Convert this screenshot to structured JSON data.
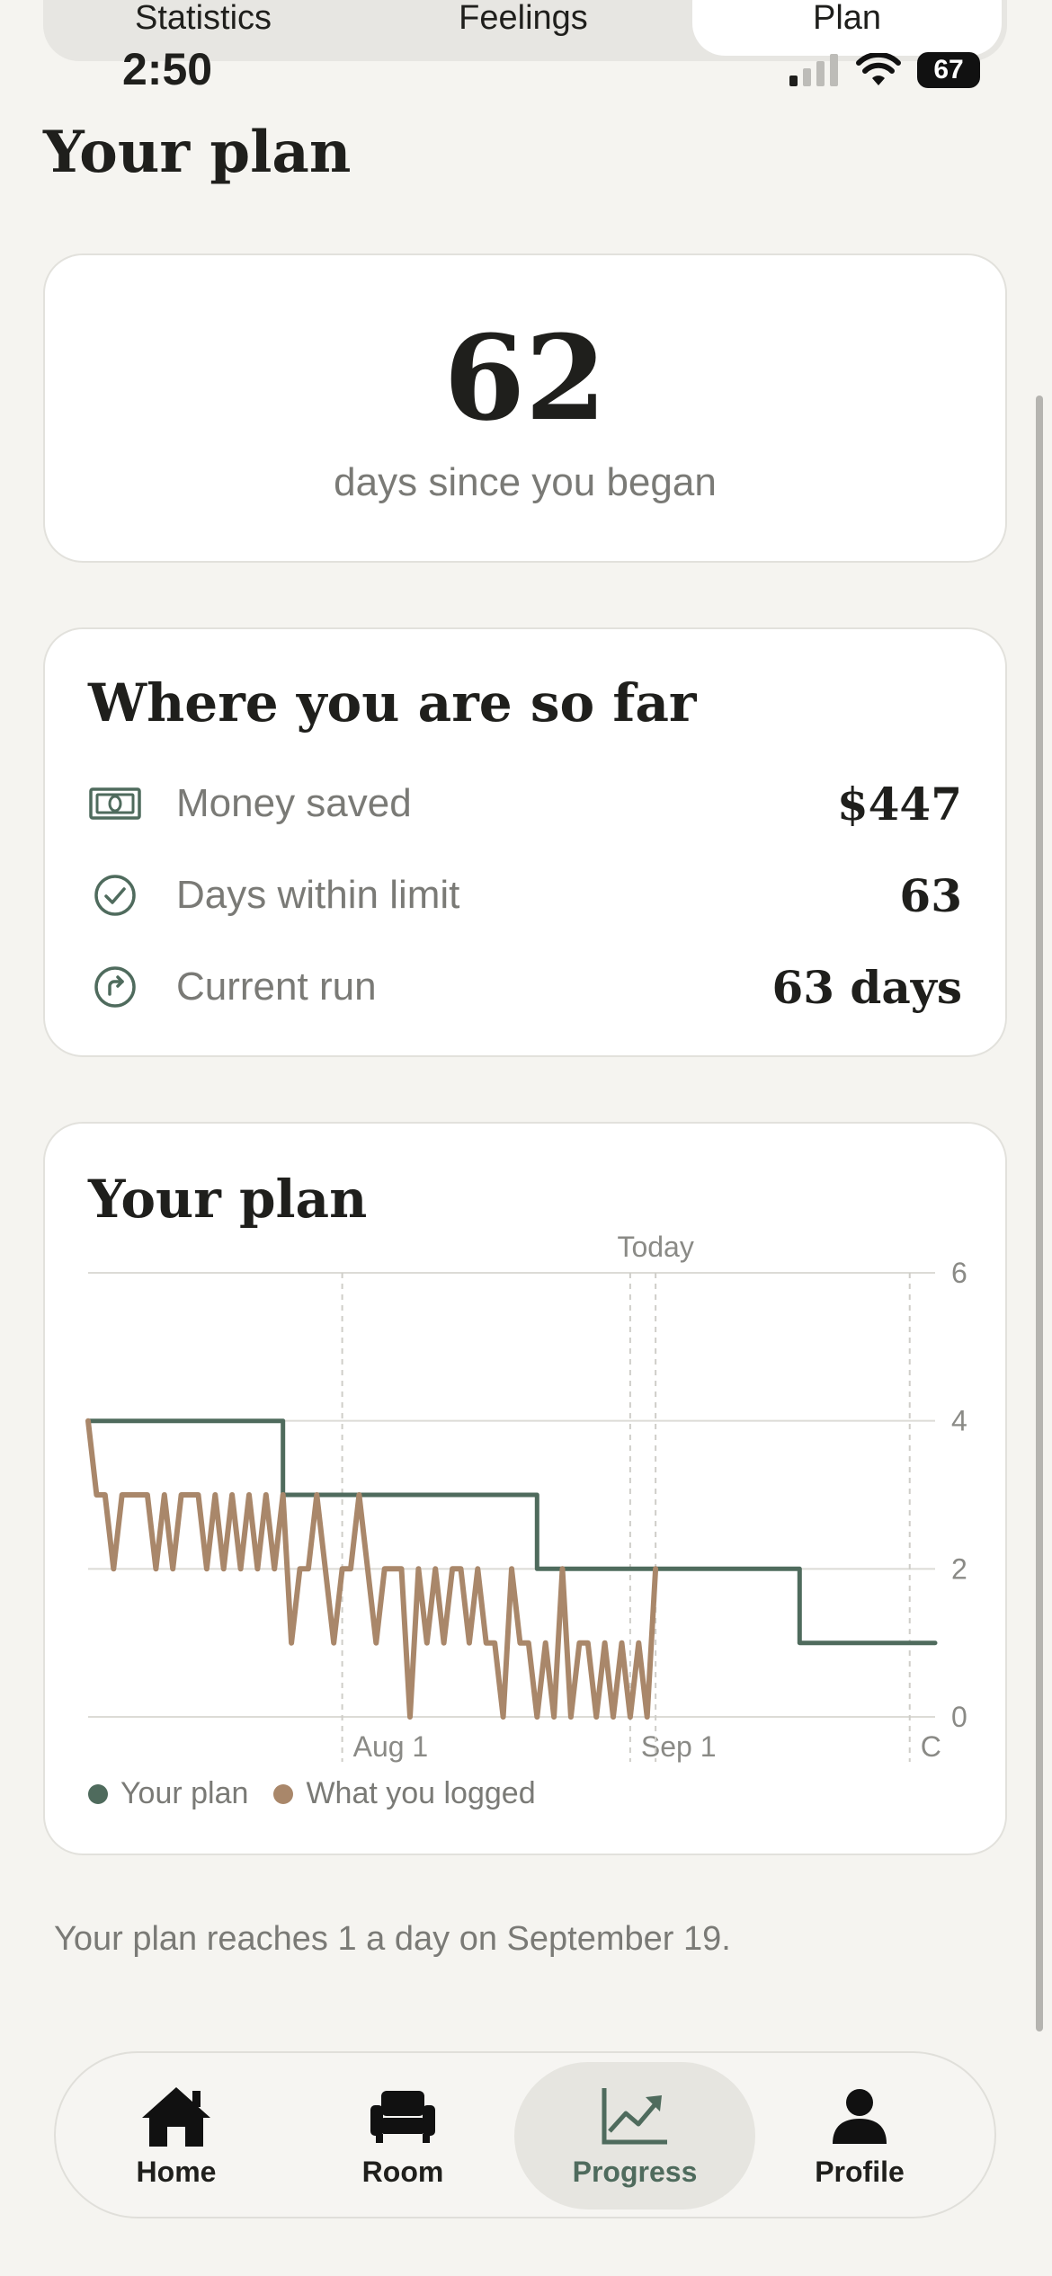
{
  "segments": [
    "Statistics",
    "Feelings",
    "Plan"
  ],
  "status": {
    "time": "2:50",
    "battery": "67"
  },
  "page_title": "Your plan",
  "days_card": {
    "number": "62",
    "caption": "days since you began"
  },
  "progress_card": {
    "title": "Where you are so far",
    "rows": [
      {
        "icon": "money-icon",
        "label": "Money saved",
        "value": "$447"
      },
      {
        "icon": "check-circle-icon",
        "label": "Days within limit",
        "value": "63"
      },
      {
        "icon": "streak-arrow-icon",
        "label": "Current run",
        "value": "63 days"
      }
    ]
  },
  "plan_card": {
    "title": "Your plan"
  },
  "colors": {
    "plan": "#4f6b5d",
    "logged": "#a9876a",
    "accent": "#4f6b5d"
  },
  "chart_data": {
    "type": "line",
    "ylim": [
      0,
      6
    ],
    "yticks": [
      0,
      2,
      4,
      6
    ],
    "xlim": [
      0,
      100
    ],
    "x_ticks": [
      {
        "label": "Aug 1",
        "x": 30
      },
      {
        "label": "Sep 1",
        "x": 64
      },
      {
        "label": "C",
        "x": 97
      }
    ],
    "today_marker": {
      "label": "Today",
      "x": 67
    },
    "grid": true,
    "legend_position": "bottom-left",
    "series": [
      {
        "name": "Your plan",
        "step": true,
        "points": [
          [
            0,
            4
          ],
          [
            23,
            4
          ],
          [
            23,
            3
          ],
          [
            53,
            3
          ],
          [
            53,
            2
          ],
          [
            84,
            2
          ],
          [
            84,
            1
          ],
          [
            100,
            1
          ]
        ]
      },
      {
        "name": "What you logged",
        "step": false,
        "points": [
          [
            0,
            4
          ],
          [
            1,
            3
          ],
          [
            2,
            3
          ],
          [
            3,
            2
          ],
          [
            4,
            3
          ],
          [
            5,
            3
          ],
          [
            6,
            3
          ],
          [
            7,
            3
          ],
          [
            8,
            2
          ],
          [
            9,
            3
          ],
          [
            10,
            2
          ],
          [
            11,
            3
          ],
          [
            12,
            3
          ],
          [
            13,
            3
          ],
          [
            14,
            2
          ],
          [
            15,
            3
          ],
          [
            16,
            2
          ],
          [
            17,
            3
          ],
          [
            18,
            2
          ],
          [
            19,
            3
          ],
          [
            20,
            2
          ],
          [
            21,
            3
          ],
          [
            22,
            2
          ],
          [
            23,
            3
          ],
          [
            24,
            1
          ],
          [
            25,
            2
          ],
          [
            26,
            2
          ],
          [
            27,
            3
          ],
          [
            28,
            2
          ],
          [
            29,
            1
          ],
          [
            30,
            2
          ],
          [
            31,
            2
          ],
          [
            32,
            3
          ],
          [
            33,
            2
          ],
          [
            34,
            1
          ],
          [
            35,
            2
          ],
          [
            36,
            2
          ],
          [
            37,
            2
          ],
          [
            38,
            0
          ],
          [
            39,
            2
          ],
          [
            40,
            1
          ],
          [
            41,
            2
          ],
          [
            42,
            1
          ],
          [
            43,
            2
          ],
          [
            44,
            2
          ],
          [
            45,
            1
          ],
          [
            46,
            2
          ],
          [
            47,
            1
          ],
          [
            48,
            1
          ],
          [
            49,
            0
          ],
          [
            50,
            2
          ],
          [
            51,
            1
          ],
          [
            52,
            1
          ],
          [
            53,
            0
          ],
          [
            54,
            1
          ],
          [
            55,
            0
          ],
          [
            56,
            2
          ],
          [
            57,
            0
          ],
          [
            58,
            1
          ],
          [
            59,
            1
          ],
          [
            60,
            0
          ],
          [
            61,
            1
          ],
          [
            62,
            0
          ],
          [
            63,
            1
          ],
          [
            64,
            0
          ],
          [
            65,
            1
          ],
          [
            66,
            0
          ],
          [
            67,
            2
          ]
        ]
      }
    ]
  },
  "footnote": "Your plan reaches 1 a day on September 19.",
  "tabs": [
    {
      "label": "Home",
      "icon": "home-icon",
      "active": false
    },
    {
      "label": "Room",
      "icon": "armchair-icon",
      "active": false
    },
    {
      "label": "Progress",
      "icon": "chart-trend-icon",
      "active": true
    },
    {
      "label": "Profile",
      "icon": "person-icon",
      "active": false
    }
  ]
}
